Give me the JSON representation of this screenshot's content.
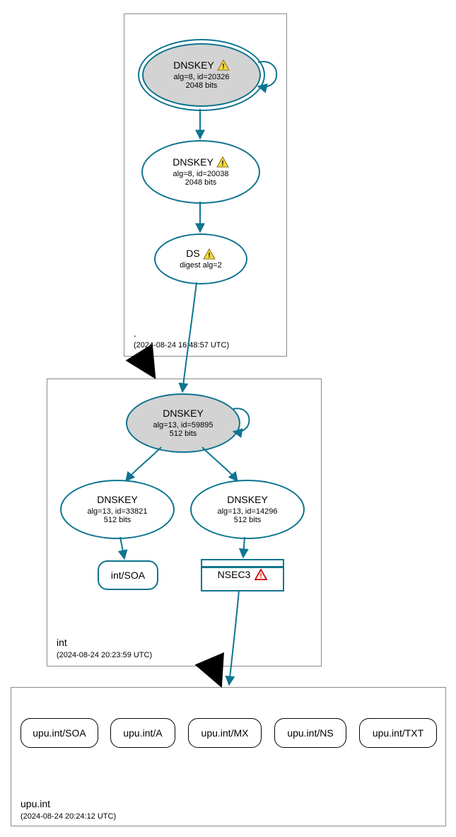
{
  "zones": {
    "root": {
      "label": ".",
      "timestamp": "(2024-08-24 16:48:57 UTC)"
    },
    "int": {
      "label": "int",
      "timestamp": "(2024-08-24 20:23:59 UTC)"
    },
    "upu": {
      "label": "upu.int",
      "timestamp": "(2024-08-24 20:24:12 UTC)"
    }
  },
  "nodes": {
    "root_ksk": {
      "title": "DNSKEY",
      "l1": "alg=8, id=20326",
      "l2": "2048 bits"
    },
    "root_zsk": {
      "title": "DNSKEY",
      "l1": "alg=8, id=20038",
      "l2": "2048 bits"
    },
    "root_ds": {
      "title": "DS",
      "l1": "digest alg=2"
    },
    "int_ksk": {
      "title": "DNSKEY",
      "l1": "alg=13, id=59895",
      "l2": "512 bits"
    },
    "int_zsk1": {
      "title": "DNSKEY",
      "l1": "alg=13, id=33821",
      "l2": "512 bits"
    },
    "int_zsk2": {
      "title": "DNSKEY",
      "l1": "alg=13, id=14296",
      "l2": "512 bits"
    },
    "int_soa": {
      "label": "int/SOA"
    },
    "nsec3": {
      "label": "NSEC3"
    },
    "upu_soa": {
      "label": "upu.int/SOA"
    },
    "upu_a": {
      "label": "upu.int/A"
    },
    "upu_mx": {
      "label": "upu.int/MX"
    },
    "upu_ns": {
      "label": "upu.int/NS"
    },
    "upu_txt": {
      "label": "upu.int/TXT"
    }
  },
  "icons": {
    "warn_yellow": "warning-yellow-icon",
    "warn_red": "warning-red-icon"
  }
}
